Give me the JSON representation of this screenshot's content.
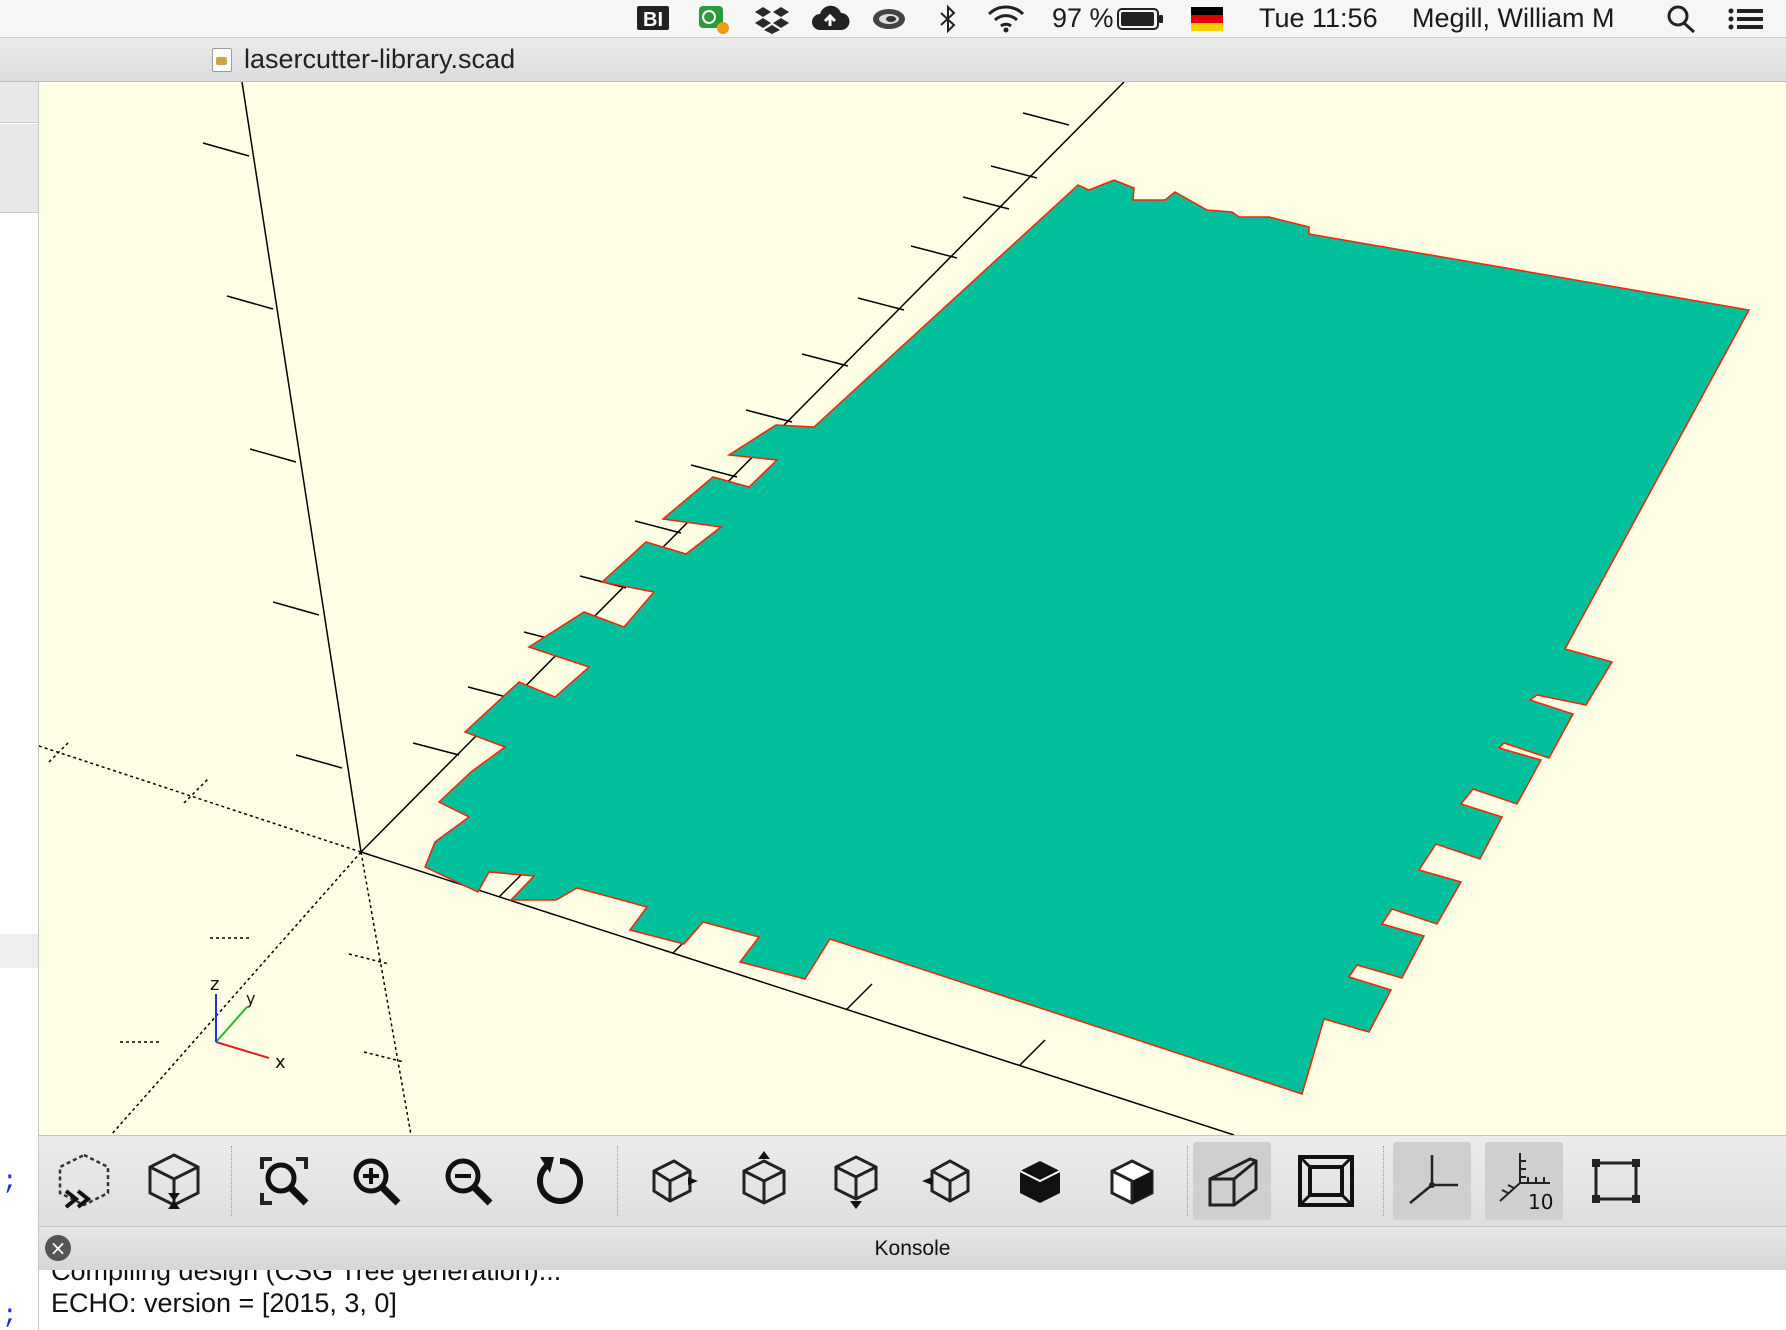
{
  "menubar": {
    "status_icons": [
      "bi-icon",
      "evernote-icon",
      "dropbox-icon",
      "cloud-upload-icon",
      "swirl-icon",
      "bluetooth-icon",
      "wifi-icon",
      "battery-icon",
      "german-flag-icon"
    ],
    "battery": "97 %",
    "clock": "Tue 11:56",
    "user": "Megill, William M",
    "bi_label": "BI"
  },
  "window": {
    "title": "lasercutter-library.scad"
  },
  "editor_strip": {
    "semicolon": ";"
  },
  "viewport": {
    "background": "#ffffe5",
    "part_fill": "#00bf9b",
    "part_edge": "#ff0000",
    "axis_labels": {
      "x": "x",
      "y": "y",
      "z": "z"
    }
  },
  "toolbar": {
    "buttons": [
      "preview-render-icon",
      "render-icon",
      "view-all-icon",
      "zoom-in-icon",
      "zoom-out-icon",
      "reset-view-icon",
      "view-right-icon",
      "view-top-icon",
      "view-bottom-icon",
      "view-left-icon",
      "view-front-icon",
      "view-back-icon",
      "perspective-icon",
      "orthogonal-icon",
      "show-axes-icon",
      "show-scale-markers-icon",
      "show-edges-icon"
    ],
    "scale_label": "10"
  },
  "console": {
    "title": "Konsole",
    "lines": [
      "Compiling design (CSG Tree generation)...",
      "ECHO: version = [2015, 3, 0]"
    ]
  }
}
